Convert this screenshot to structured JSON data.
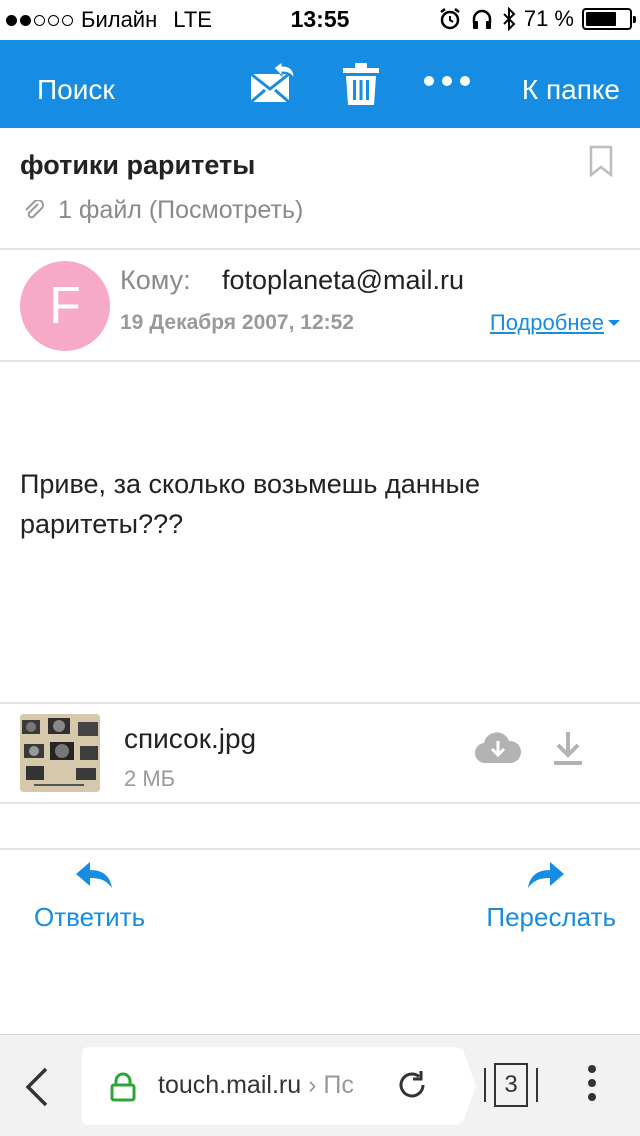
{
  "status_bar": {
    "carrier": "Билайн",
    "network": "LTE",
    "time": "13:55",
    "battery_percent": "71 %",
    "battery_level": 0.71
  },
  "toolbar": {
    "search_label": "Поиск",
    "folder_label": "К папке",
    "accent": "#168de2"
  },
  "message": {
    "subject": "фотики раритеты",
    "attachments_summary": "1 файл (Посмотреть)",
    "avatar_letter": "F",
    "avatar_color": "#f7a9c8",
    "to_label": "Кому:",
    "to_address": "fotoplaneta@mail.ru",
    "date": "19 Декабря 2007, 12:52",
    "details_label": "Подробнее",
    "body_line1": "Приве, за сколько возьмешь данные",
    "body_line2": "раритеты???"
  },
  "attachment": {
    "file_name": "список.jpg",
    "file_size": "2 МБ"
  },
  "actions": {
    "reply_label": "Ответить",
    "forward_label": "Переслать"
  },
  "browser": {
    "url_host": "touch.mail.ru",
    "url_separator": "›",
    "url_rest": "Пс",
    "tab_count": "3"
  }
}
